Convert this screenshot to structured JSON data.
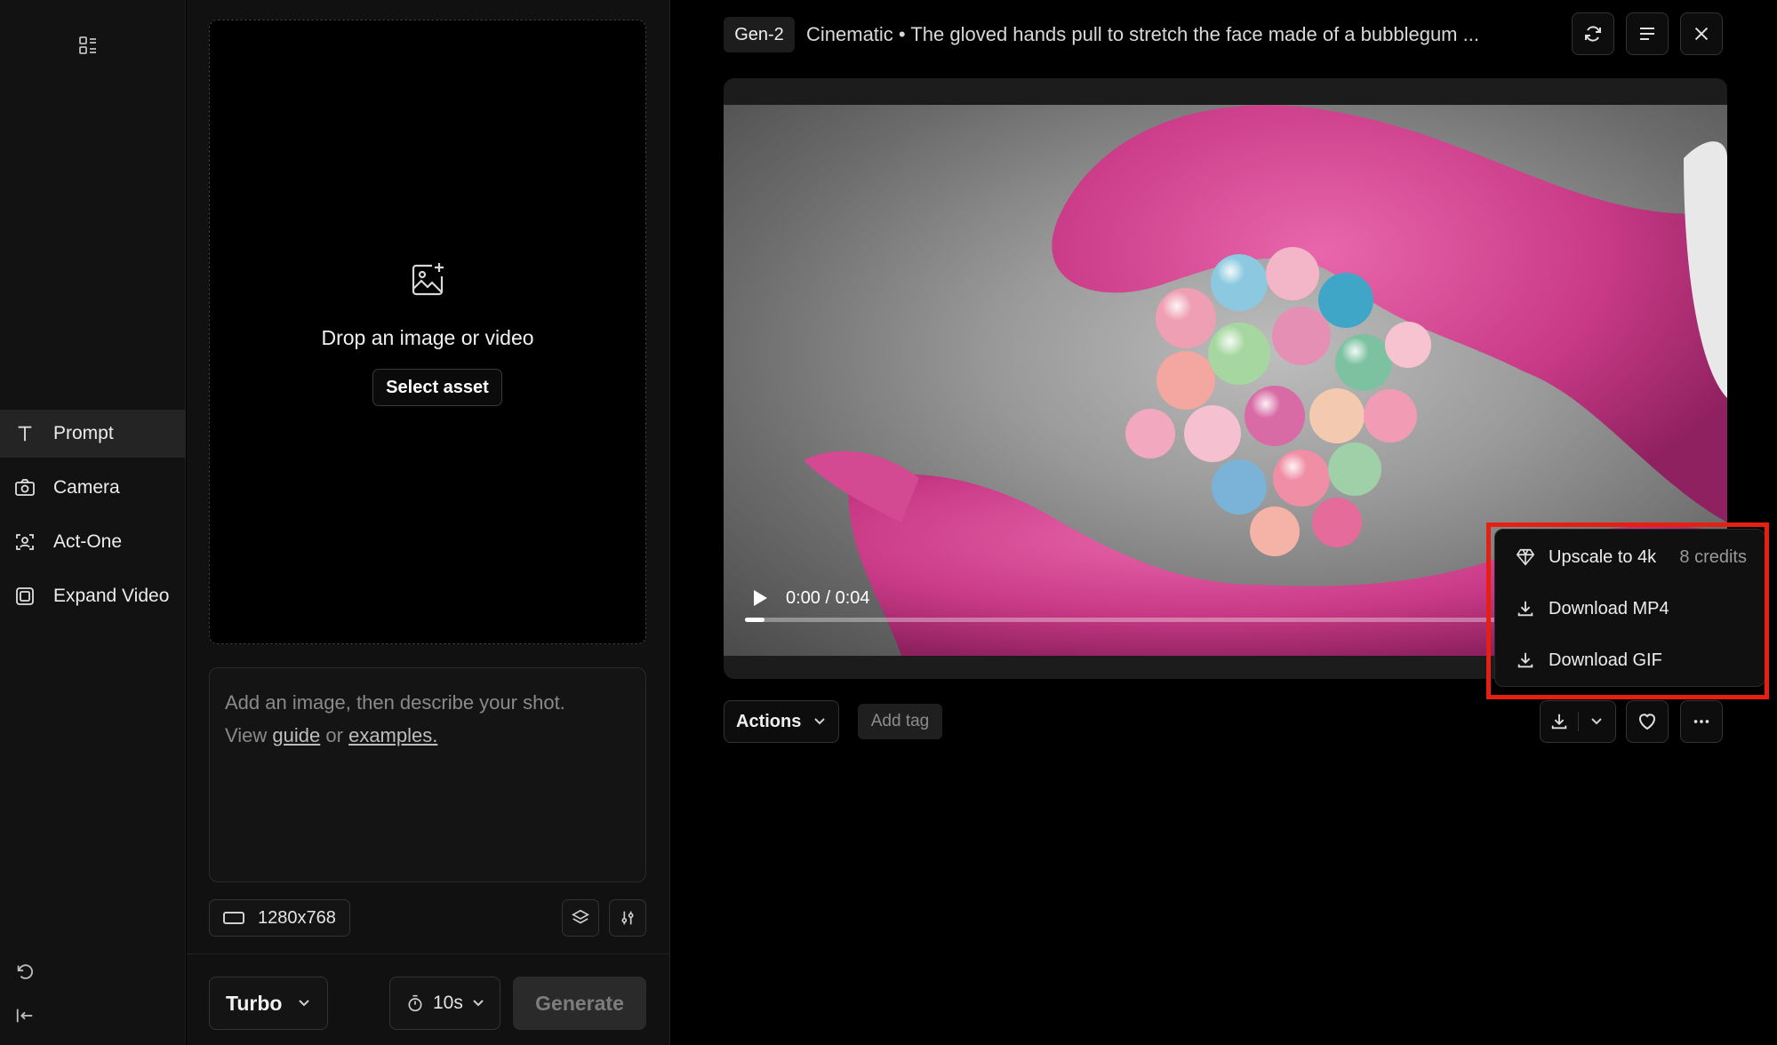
{
  "sidebar": {
    "items": [
      {
        "label": "Prompt",
        "icon": "text-icon"
      },
      {
        "label": "Camera",
        "icon": "camera-icon"
      },
      {
        "label": "Act-One",
        "icon": "face-scan-icon"
      },
      {
        "label": "Expand Video",
        "icon": "expand-icon"
      }
    ],
    "active": "Prompt"
  },
  "panel": {
    "drop_text": "Drop an image or video",
    "select_label": "Select asset",
    "prompt_placeholder": "Add an image, then describe your shot.",
    "view_text": "View",
    "guide_link": "guide",
    "or_text": "or",
    "examples_link": "examples.",
    "resolution": "1280x768",
    "model": "Turbo",
    "duration": "10s",
    "generate_label": "Generate"
  },
  "main": {
    "model_badge": "Gen-2",
    "title": "Cinematic • The gloved hands pull to stretch the face made of a bubblegum ...",
    "player": {
      "time": "0:00 / 0:04",
      "progress": 0.0
    },
    "actions_label": "Actions",
    "add_tag_label": "Add tag"
  },
  "download_menu": {
    "items": [
      {
        "label": "Upscale to 4k",
        "credits": "8 credits",
        "icon": "diamond-icon"
      },
      {
        "label": "Download MP4",
        "icon": "download-icon"
      },
      {
        "label": "Download GIF",
        "icon": "download-icon"
      }
    ],
    "highlight_color": "#e52012"
  },
  "colors": {
    "background": "#000000",
    "sidebar": "#121212",
    "panel": "#111111",
    "glove_pink": "#d4418f"
  }
}
